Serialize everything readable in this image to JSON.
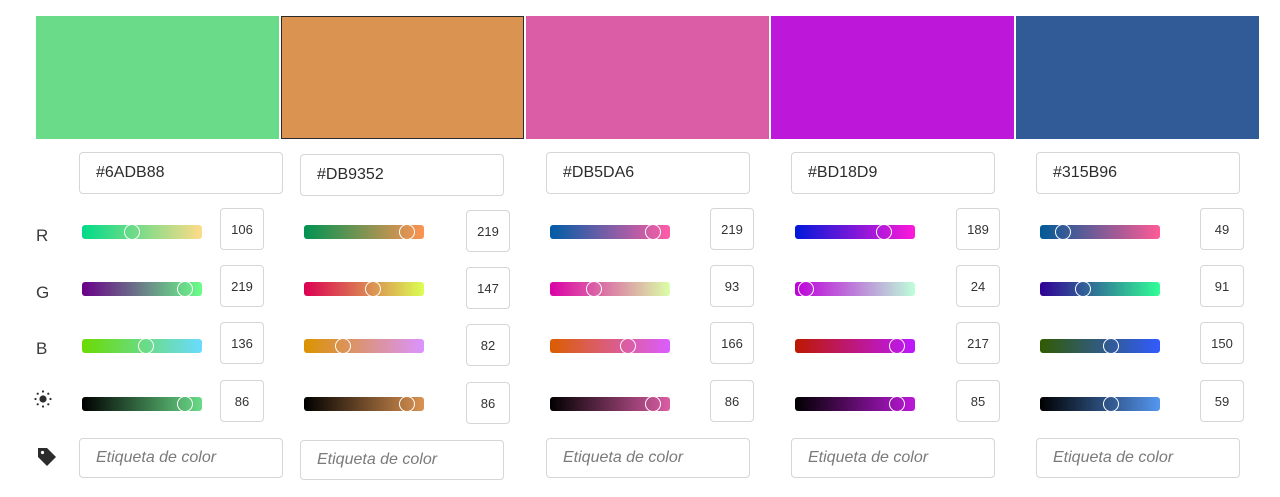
{
  "channel_labels": {
    "r": "R",
    "g": "G",
    "b": "B"
  },
  "icons": {
    "brightness": "sun-icon",
    "label": "tag-icon"
  },
  "tag_placeholder": "Etiqueta de color",
  "selected_index": 1,
  "colors": [
    {
      "hex": "#6ADB88",
      "swatch": "#6ADB88",
      "r": {
        "value": "106",
        "grad": "linear-gradient(to right,#00DB88,#FFDB88)"
      },
      "g": {
        "value": "219",
        "grad": "linear-gradient(to right,#6A0088,#6AFF88)"
      },
      "b": {
        "value": "136",
        "grad": "linear-gradient(to right,#6ADB00,#6ADBFF)"
      },
      "brightness": {
        "value": "86",
        "grad": "linear-gradient(to right,#000000,#6ADB88)"
      },
      "tag": ""
    },
    {
      "hex": "#DB9352",
      "swatch": "#DB9352",
      "r": {
        "value": "219",
        "grad": "linear-gradient(to right,#009352,#FF9352)"
      },
      "g": {
        "value": "147",
        "grad": "linear-gradient(to right,#DB0052,#DBFF52)"
      },
      "b": {
        "value": "82",
        "grad": "linear-gradient(to right,#DB9300,#DB93FF)"
      },
      "brightness": {
        "value": "86",
        "grad": "linear-gradient(to right,#000000,#DB9352)"
      },
      "tag": ""
    },
    {
      "hex": "#DB5DA6",
      "swatch": "#DB5DA6",
      "r": {
        "value": "219",
        "grad": "linear-gradient(to right,#005DA6,#FF5DA6)"
      },
      "g": {
        "value": "93",
        "grad": "linear-gradient(to right,#DB00A6,#DBFFA6)"
      },
      "b": {
        "value": "166",
        "grad": "linear-gradient(to right,#DB5D00,#DB5DFF)"
      },
      "brightness": {
        "value": "86",
        "grad": "linear-gradient(to right,#000000,#DB5DA6)"
      },
      "tag": ""
    },
    {
      "hex": "#BD18D9",
      "swatch": "#BD18D9",
      "r": {
        "value": "189",
        "grad": "linear-gradient(to right,#0018D9,#FF18D9)"
      },
      "g": {
        "value": "24",
        "grad": "linear-gradient(to right,#BD00D9,#BDFFD9)"
      },
      "b": {
        "value": "217",
        "grad": "linear-gradient(to right,#BD1800,#BD18FF)"
      },
      "brightness": {
        "value": "85",
        "grad": "linear-gradient(to right,#000000,#BD18D9)"
      },
      "tag": ""
    },
    {
      "hex": "#315B96",
      "swatch": "#315B96",
      "r": {
        "value": "49",
        "grad": "linear-gradient(to right,#005B96,#FF5B96)"
      },
      "g": {
        "value": "91",
        "grad": "linear-gradient(to right,#310096,#31FF96)"
      },
      "b": {
        "value": "150",
        "grad": "linear-gradient(to right,#315B00,#315BFF)"
      },
      "brightness": {
        "value": "59",
        "grad": "linear-gradient(to right,#000000,#5596F0)"
      },
      "tag": ""
    }
  ]
}
